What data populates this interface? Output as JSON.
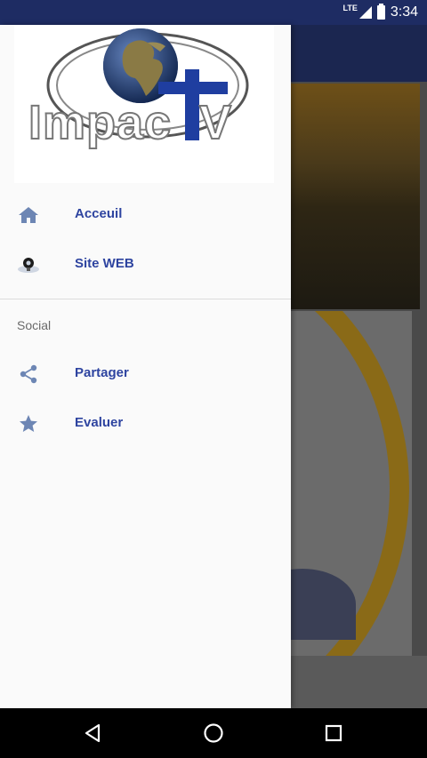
{
  "status_bar": {
    "network": "LTE",
    "time": "3:34"
  },
  "drawer": {
    "logo_text": "ImpacTV",
    "items": [
      {
        "label": "Acceuil",
        "icon": "home-icon"
      },
      {
        "label": "Site WEB",
        "icon": "webcam-icon"
      }
    ],
    "section_title": "Social",
    "social_items": [
      {
        "label": "Partager",
        "icon": "share-icon"
      },
      {
        "label": "Evaluer",
        "icon": "star-icon"
      }
    ]
  },
  "nav_bar": {
    "buttons": [
      "back",
      "home",
      "recents"
    ]
  },
  "colors": {
    "status_bar": "#1e2c63",
    "toolbar": "#1b2650",
    "drawer_label": "#2e44a0",
    "icon_tint": "#6d86b4"
  }
}
